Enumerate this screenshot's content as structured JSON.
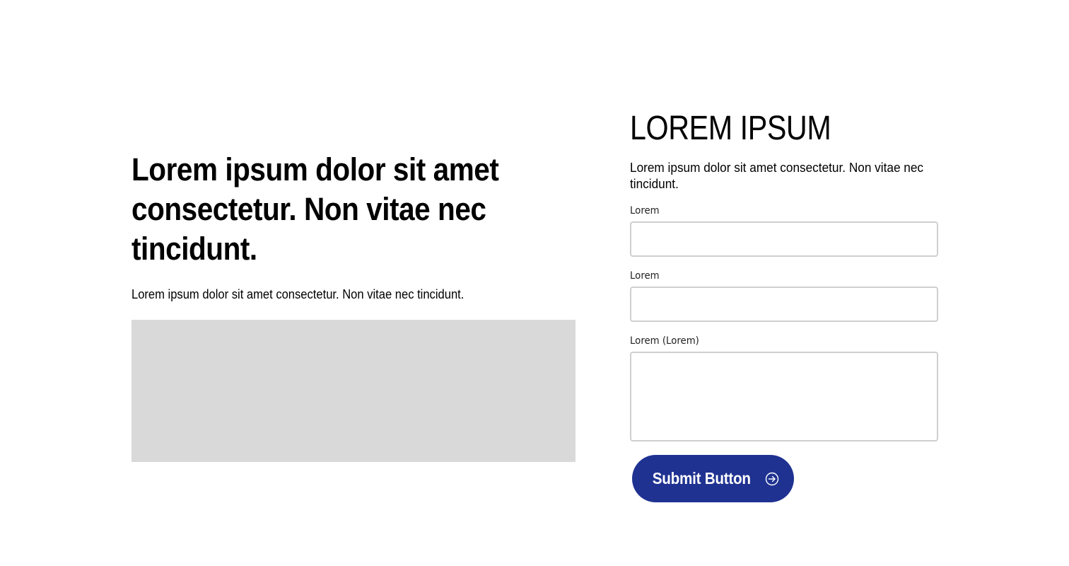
{
  "hero": {
    "heading": "Lorem ipsum dolor sit amet consectetur. Non vitae nec tincidunt.",
    "text": "Lorem ipsum dolor sit amet consectetur. Non vitae nec tincidunt."
  },
  "form": {
    "title": "LOREM IPSUM",
    "description": "Lorem ipsum dolor sit amet consectetur. Non vitae nec tincidunt.",
    "fields": [
      {
        "label": "Lorem",
        "value": ""
      },
      {
        "label": "Lorem",
        "value": ""
      },
      {
        "label": "Lorem (Lorem)",
        "value": ""
      }
    ],
    "submit_label": "Submit Button",
    "submit_icon": "arrow-right-circle-icon"
  },
  "colors": {
    "button_bg": "#1f3291",
    "placeholder_bg": "#d9d9d9",
    "input_border": "#cfcfcf"
  }
}
